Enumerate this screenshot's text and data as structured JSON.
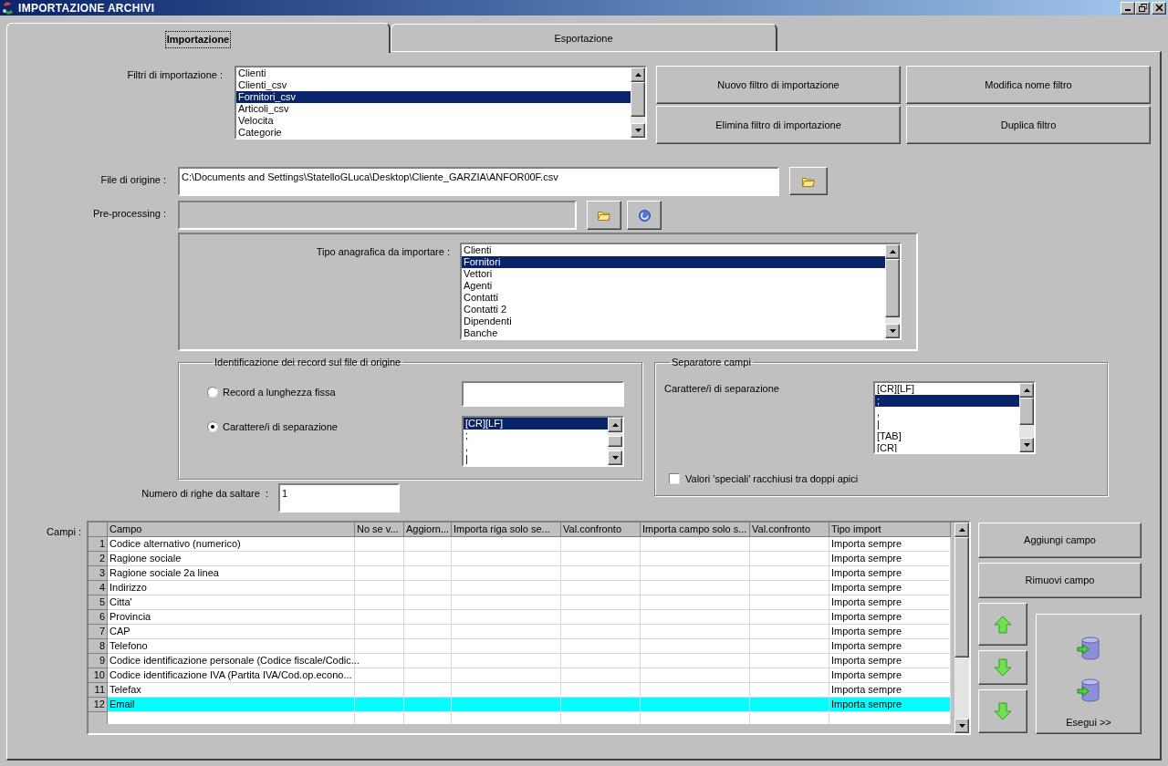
{
  "window": {
    "title": "IMPORTAZIONE ARCHIVI"
  },
  "tabs": [
    {
      "label": "Importazione",
      "selected": true
    },
    {
      "label": "Esportazione",
      "selected": false
    }
  ],
  "import_filters": {
    "label": "Filtri di importazione :",
    "items": [
      {
        "label": "Clienti",
        "selected": false
      },
      {
        "label": "Clienti_csv",
        "selected": false
      },
      {
        "label": "Fornitori_csv",
        "selected": true
      },
      {
        "label": "Articoli_csv",
        "selected": false
      },
      {
        "label": "Velocita",
        "selected": false
      },
      {
        "label": "Categorie",
        "selected": false
      }
    ]
  },
  "filter_buttons": [
    "Nuovo filtro di importazione",
    "Modifica nome filtro",
    "Elimina filtro di importazione",
    "Duplica filtro"
  ],
  "source_file": {
    "label": "File di origine :",
    "value": "C:\\Documents and Settings\\StatelloGLuca\\Desktop\\Cliente_GARZIA\\ANFOR00F.csv"
  },
  "preprocessing": {
    "label": "Pre-processing :",
    "disabled": true
  },
  "registry_type": {
    "label": "Tipo anagrafica da importare :",
    "items": [
      {
        "label": "Clienti",
        "selected": false
      },
      {
        "label": "Fornitori",
        "selected": true
      },
      {
        "label": "Vettori",
        "selected": false
      },
      {
        "label": "Agenti",
        "selected": false
      },
      {
        "label": "Contatti",
        "selected": false
      },
      {
        "label": "Contatti 2",
        "selected": false
      },
      {
        "label": "Dipendenti",
        "selected": false
      },
      {
        "label": "Banche",
        "selected": false
      }
    ]
  },
  "record_identification": {
    "title": "Identificazione dei record sul file di origine",
    "options": [
      {
        "label": "Record a lunghezza fissa",
        "selected": false
      },
      {
        "label": "Carattere/i di separazione",
        "selected": true
      }
    ],
    "separators": [
      {
        "label": "[CR][LF]",
        "selected": true
      },
      {
        "label": ";",
        "selected": false
      },
      {
        "label": ",",
        "selected": false
      },
      {
        "label": "|",
        "selected": false
      }
    ]
  },
  "field_separator": {
    "title": "Separatore campi",
    "label": "Carattere/i di separazione",
    "items": [
      {
        "label": "[CR][LF]",
        "selected": false
      },
      {
        "label": ";",
        "selected": true
      },
      {
        "label": ",",
        "selected": false
      },
      {
        "label": "|",
        "selected": false
      },
      {
        "label": "[TAB]",
        "selected": false
      },
      {
        "label": "[CR]",
        "selected": false
      }
    ],
    "quoted_values": {
      "label": "Valori 'speciali' racchiusi tra doppi apici",
      "checked": false
    }
  },
  "skip_rows": {
    "label": "Numero di righe da saltare  :",
    "value": "1"
  },
  "fields": {
    "label": "Campi :",
    "columns": [
      "Campo",
      "No se v...",
      "Aggiorn...",
      "Importa riga solo se...",
      "Val.confronto",
      "Importa campo solo s...",
      "Val.confronto",
      "Tipo import"
    ],
    "rows": [
      {
        "number": "1",
        "campo": "Codice alternativo (numerico)",
        "tipo_import": "Importa sempre",
        "selected": false
      },
      {
        "number": "2",
        "campo": "Ragione sociale",
        "tipo_import": "Importa sempre",
        "selected": false
      },
      {
        "number": "3",
        "campo": "Ragione sociale 2a linea",
        "tipo_import": "Importa sempre",
        "selected": false
      },
      {
        "number": "4",
        "campo": "Indirizzo",
        "tipo_import": "Importa sempre",
        "selected": false
      },
      {
        "number": "5",
        "campo": "Citta'",
        "tipo_import": "Importa sempre",
        "selected": false
      },
      {
        "number": "6",
        "campo": "Provincia",
        "tipo_import": "Importa sempre",
        "selected": false
      },
      {
        "number": "7",
        "campo": "CAP",
        "tipo_import": "Importa sempre",
        "selected": false
      },
      {
        "number": "8",
        "campo": "Telefono",
        "tipo_import": "Importa sempre",
        "selected": false
      },
      {
        "number": "9",
        "campo": "Codice identificazione personale (Codice fiscale/Codic...",
        "tipo_import": "Importa sempre",
        "selected": false
      },
      {
        "number": "10",
        "campo": "Codice identificazione IVA (Partita IVA/Cod.op.econo...",
        "tipo_import": "Importa sempre",
        "selected": false
      },
      {
        "number": "11",
        "campo": "Telefax",
        "tipo_import": "Importa sempre",
        "selected": false
      },
      {
        "number": "12",
        "campo": "Email",
        "tipo_import": "Importa sempre",
        "selected": true
      }
    ]
  },
  "field_buttons": [
    "Aggiungi campo",
    "Rimuovi campo"
  ],
  "run_button": {
    "label": "Esegui >>"
  }
}
